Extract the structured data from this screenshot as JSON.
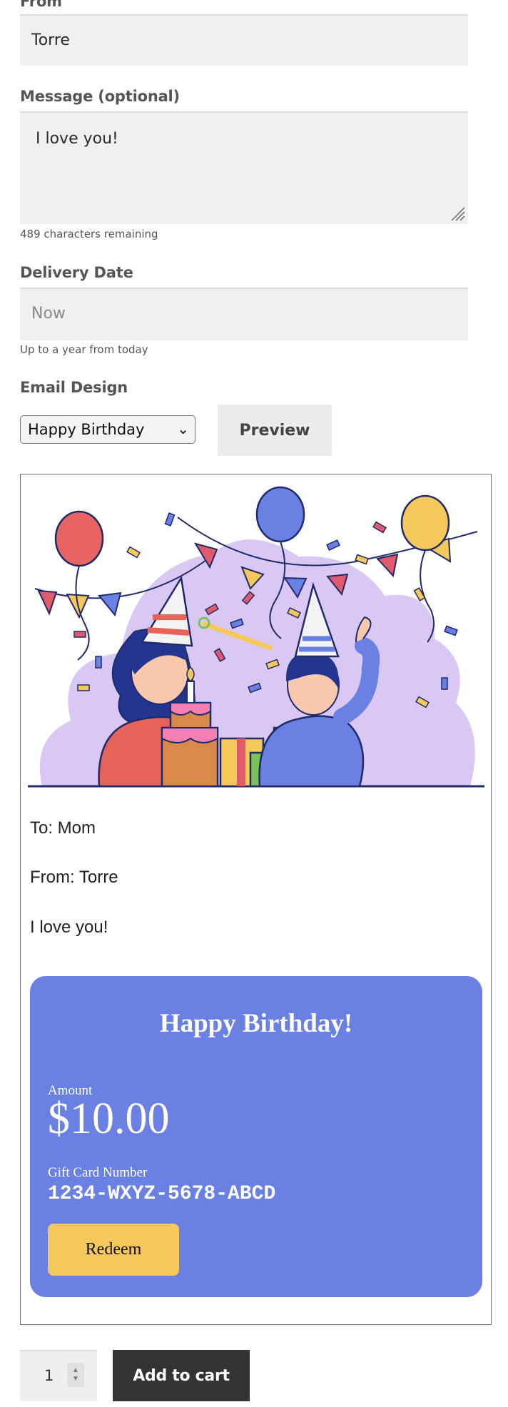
{
  "form": {
    "from_label": "From",
    "from_value": "Torre",
    "message_label": "Message (optional)",
    "message_value": "I love you!",
    "chars_remaining": "489 characters remaining",
    "delivery_label": "Delivery Date",
    "delivery_placeholder": "Now",
    "delivery_hint": "Up to a year from today",
    "design_label": "Email Design",
    "design_selected": "Happy Birthday",
    "preview_label": "Preview"
  },
  "card": {
    "to_line": "To: Mom",
    "from_line": "From: Torre",
    "message_line": "I love you!",
    "heading": "Happy Birthday!",
    "amount_label": "Amount",
    "amount": "$10.00",
    "number_label": "Gift Card Number",
    "number": "1234-WXYZ-5678-ABCD",
    "redeem_label": "Redeem",
    "color": "#6a80e2",
    "redeem_color": "#f5c85b"
  },
  "cart": {
    "quantity": "1",
    "add_label": "Add to cart"
  }
}
